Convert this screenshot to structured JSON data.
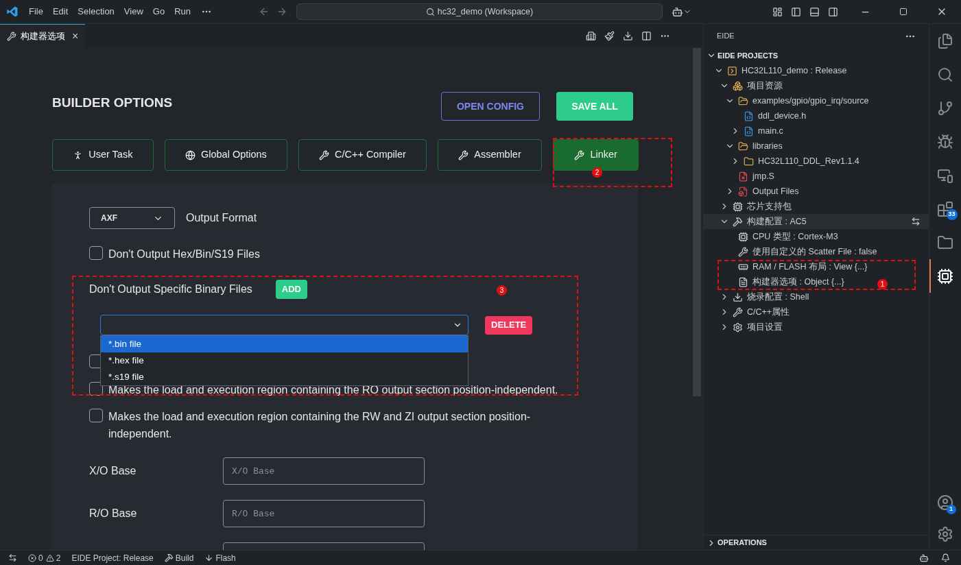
{
  "title_bar": {
    "menu": [
      "File",
      "Edit",
      "Selection",
      "View",
      "Go",
      "Run"
    ],
    "search": "hc32_demo (Workspace)"
  },
  "editor_tab": {
    "label": "构建器选项",
    "close": "×"
  },
  "builder": {
    "title": "BUILDER OPTIONS",
    "open_config": "OPEN CONFIG",
    "save_all": "SAVE ALL",
    "tabs": [
      {
        "label": "User Task",
        "kind": "run",
        "selected": false
      },
      {
        "label": "Global Options",
        "kind": "globe",
        "selected": false
      },
      {
        "label": "C/C++ Compiler",
        "kind": "tools",
        "selected": false
      },
      {
        "label": "Assembler",
        "kind": "tools",
        "selected": false
      },
      {
        "label": "Linker",
        "kind": "tools",
        "selected": true
      }
    ],
    "output_format": {
      "value": "AXF",
      "label": "Output Format"
    },
    "no_hex": {
      "label": "Don't Output Hex/Bin/S19 Files",
      "checked": false
    },
    "specific": {
      "label": "Don't Output Specific Binary Files",
      "add": "ADD",
      "delete": "DELETE",
      "options": [
        {
          "label": "*.bin file",
          "selected": true
        },
        {
          "label": "*.hex file",
          "selected": false
        },
        {
          "label": "*.s19 file",
          "selected": false
        }
      ]
    },
    "hidden_checkbox": {
      "checked": false
    },
    "ro_pi": {
      "label": "Makes the load and execution region containing the RO output section position-independent.",
      "checked": false
    },
    "rw_pi": {
      "label": "Makes the load and execution region containing the RW and ZI output section position-independent.",
      "checked": false
    },
    "fields": [
      {
        "label": "X/O Base",
        "placeholder": "X/O Base"
      },
      {
        "label": "R/O Base",
        "placeholder": "R/O Base"
      }
    ]
  },
  "annotations": [
    "1",
    "2",
    "3"
  ],
  "sidebar": {
    "title": "EIDE",
    "section": "EIDE PROJECTS",
    "bottom_section": "OPERATIONS",
    "tree": [
      {
        "label": "HC32L110_demo : Release",
        "kind": "project",
        "expanded": true,
        "selected": false,
        "children": [
          {
            "label": "项目资源",
            "kind": "source",
            "expanded": true,
            "selected": false,
            "children": [
              {
                "label": "examples/gpio/gpio_irq/source",
                "kind": "folder",
                "expanded": true,
                "selected": false,
                "children": [
                  {
                    "label": "ddl_device.h",
                    "kind": "header",
                    "selected": false
                  },
                  {
                    "label": "main.c",
                    "kind": "cfile",
                    "expanded": false,
                    "selected": false
                  }
                ]
              },
              {
                "label": "libraries",
                "kind": "folder",
                "expanded": true,
                "selected": false,
                "children": [
                  {
                    "label": "HC32L110_DDL_Rev1.1.4",
                    "kind": "plainfolder",
                    "expanded": false,
                    "selected": false
                  }
                ]
              },
              {
                "label": "jmp.S",
                "kind": "excluded",
                "selected": false
              },
              {
                "label": "Output Files",
                "kind": "output",
                "expanded": false,
                "selected": false
              }
            ]
          },
          {
            "label": "芯片支持包",
            "kind": "chip",
            "expanded": false,
            "selected": false
          },
          {
            "label": "构建配置 : AC5",
            "kind": "hammer",
            "expanded": true,
            "selected": true,
            "children": [
              {
                "label": "CPU 类型 : Cortex-M3",
                "kind": "chip",
                "selected": false
              },
              {
                "label": "使用自定义的 Scatter File : false",
                "kind": "wrench",
                "selected": false
              },
              {
                "label": "RAM / FLASH 布局 : View {...}",
                "kind": "memory",
                "selected": false
              },
              {
                "label": "构建器选项 : Object {...}",
                "kind": "options",
                "selected": false
              }
            ]
          },
          {
            "label": "烧录配置 : Shell",
            "kind": "download",
            "expanded": false,
            "selected": false
          },
          {
            "label": "C/C++属性",
            "kind": "wrench",
            "expanded": false,
            "selected": false
          },
          {
            "label": "项目设置",
            "kind": "gear",
            "expanded": false,
            "selected": false
          }
        ]
      }
    ]
  },
  "activity_bar": [
    {
      "kind": "files",
      "selected": false
    },
    {
      "kind": "search",
      "selected": false
    },
    {
      "kind": "git",
      "selected": false
    },
    {
      "kind": "debug",
      "selected": false
    },
    {
      "kind": "remote",
      "selected": false
    },
    {
      "kind": "extensions",
      "badge": "33",
      "selected": false
    },
    {
      "kind": "folder",
      "selected": false
    },
    {
      "kind": "chip",
      "selected": true
    }
  ],
  "activity_bottom": [
    {
      "kind": "account",
      "badge": "1"
    },
    {
      "kind": "gear"
    }
  ],
  "status_bar": {
    "errors": "0",
    "warnings": "2",
    "project": "EIDE Project: Release",
    "build": "Build",
    "flash": "Flash"
  }
}
